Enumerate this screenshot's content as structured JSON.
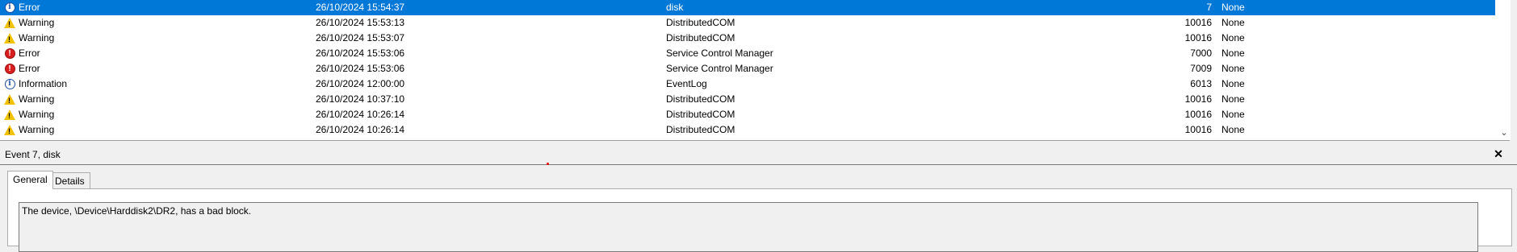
{
  "events": [
    {
      "level": "Error",
      "icon": "info-icon",
      "date": "26/10/2024 15:54:37",
      "source": "disk",
      "event_id": "7",
      "category": "None",
      "selected": true
    },
    {
      "level": "Warning",
      "icon": "warning-icon",
      "date": "26/10/2024 15:53:13",
      "source": "DistributedCOM",
      "event_id": "10016",
      "category": "None"
    },
    {
      "level": "Warning",
      "icon": "warning-icon",
      "date": "26/10/2024 15:53:07",
      "source": "DistributedCOM",
      "event_id": "10016",
      "category": "None"
    },
    {
      "level": "Error",
      "icon": "error-icon",
      "date": "26/10/2024 15:53:06",
      "source": "Service Control Manager",
      "event_id": "7000",
      "category": "None"
    },
    {
      "level": "Error",
      "icon": "error-icon",
      "date": "26/10/2024 15:53:06",
      "source": "Service Control Manager",
      "event_id": "7009",
      "category": "None"
    },
    {
      "level": "Information",
      "icon": "info-icon",
      "date": "26/10/2024 12:00:00",
      "source": "EventLog",
      "event_id": "6013",
      "category": "None"
    },
    {
      "level": "Warning",
      "icon": "warning-icon",
      "date": "26/10/2024 10:37:10",
      "source": "DistributedCOM",
      "event_id": "10016",
      "category": "None"
    },
    {
      "level": "Warning",
      "icon": "warning-icon",
      "date": "26/10/2024 10:26:14",
      "source": "DistributedCOM",
      "event_id": "10016",
      "category": "None"
    },
    {
      "level": "Warning",
      "icon": "warning-icon",
      "date": "26/10/2024 10:26:14",
      "source": "DistributedCOM",
      "event_id": "10016",
      "category": "None"
    }
  ],
  "detail": {
    "title": "Event 7, disk",
    "close_label": "✕",
    "tabs": [
      "General",
      "Details"
    ],
    "message": "The device, \\Device\\Harddisk2\\DR2, has a bad block."
  },
  "colors": {
    "selection": "#0078d7",
    "error": "#d81e1e",
    "warning": "#f2c200",
    "info": "#1f4fa8"
  }
}
